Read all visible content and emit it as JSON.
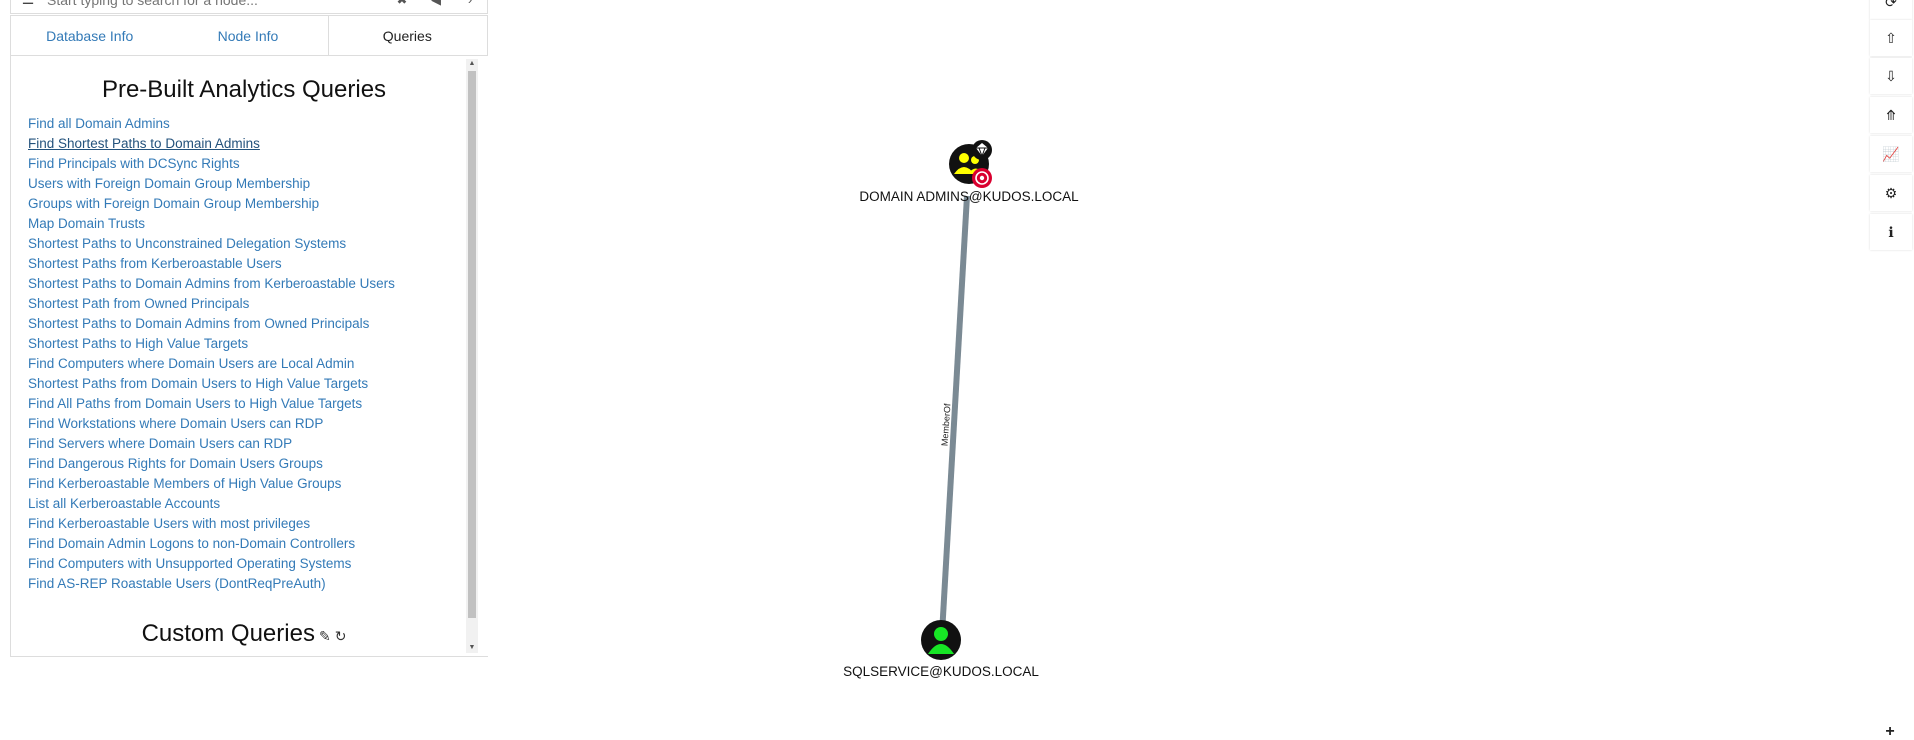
{
  "search": {
    "placeholder": "Start typing to search for a node..."
  },
  "tabs": [
    {
      "label": "Database Info"
    },
    {
      "label": "Node Info"
    },
    {
      "label": "Queries"
    }
  ],
  "prebuilt": {
    "title": "Pre-Built Analytics Queries",
    "queries": [
      "Find all Domain Admins",
      "Find Shortest Paths to Domain Admins",
      "Find Principals with DCSync Rights",
      "Users with Foreign Domain Group Membership",
      "Groups with Foreign Domain Group Membership",
      "Map Domain Trusts",
      "Shortest Paths to Unconstrained Delegation Systems",
      "Shortest Paths from Kerberoastable Users",
      "Shortest Paths to Domain Admins from Kerberoastable Users",
      "Shortest Path from Owned Principals",
      "Shortest Paths to Domain Admins from Owned Principals",
      "Shortest Paths to High Value Targets",
      "Find Computers where Domain Users are Local Admin",
      "Shortest Paths from Domain Users to High Value Targets",
      "Find All Paths from Domain Users to High Value Targets",
      "Find Workstations where Domain Users can RDP",
      "Find Servers where Domain Users can RDP",
      "Find Dangerous Rights for Domain Users Groups",
      "Find Kerberoastable Members of High Value Groups",
      "List all Kerberoastable Accounts",
      "Find Kerberoastable Users with most privileges",
      "Find Domain Admin Logons to non-Domain Controllers",
      "Find Computers with Unsupported Operating Systems",
      "Find AS-REP Roastable Users (DontReqPreAuth)"
    ]
  },
  "custom": {
    "title": "Custom Queries"
  },
  "graph": {
    "nodes": [
      {
        "label": "DOMAIN ADMINS@KUDOS.LOCAL",
        "type": "group",
        "color": "#ffff00"
      },
      {
        "label": "SQLSERVICE@KUDOS.LOCAL",
        "type": "user",
        "color": "#17e625"
      }
    ],
    "edge": {
      "label": "MemberOf",
      "color": "#7b8a94"
    }
  },
  "toolbar": [
    {
      "icon": "refresh-icon"
    },
    {
      "icon": "upload-icon"
    },
    {
      "icon": "download-icon"
    },
    {
      "icon": "upload-circle-icon"
    },
    {
      "icon": "chart-icon"
    },
    {
      "icon": "settings-icon"
    },
    {
      "icon": "info-icon"
    }
  ]
}
